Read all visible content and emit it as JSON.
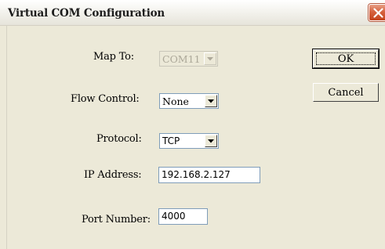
{
  "window": {
    "title": "Virtual COM Configuration",
    "close_icon": "close-x-icon"
  },
  "fields": {
    "map_to": {
      "label": "Map To:",
      "value": "COM11",
      "enabled": false
    },
    "flow_control": {
      "label": "Flow Control:",
      "value": "None"
    },
    "protocol": {
      "label": "Protocol:",
      "value": "TCP"
    },
    "ip_address": {
      "label": "IP Address:",
      "value": "192.168.2.127"
    },
    "port_number": {
      "label": "Port Number:",
      "value": "4000"
    }
  },
  "buttons": {
    "ok_label": "OK",
    "cancel_label": "Cancel"
  },
  "colors": {
    "dialog_background": "#ece9d8",
    "close_button": "#d6623e",
    "field_border": "#7f9db9",
    "disabled_text": "#aca899"
  }
}
